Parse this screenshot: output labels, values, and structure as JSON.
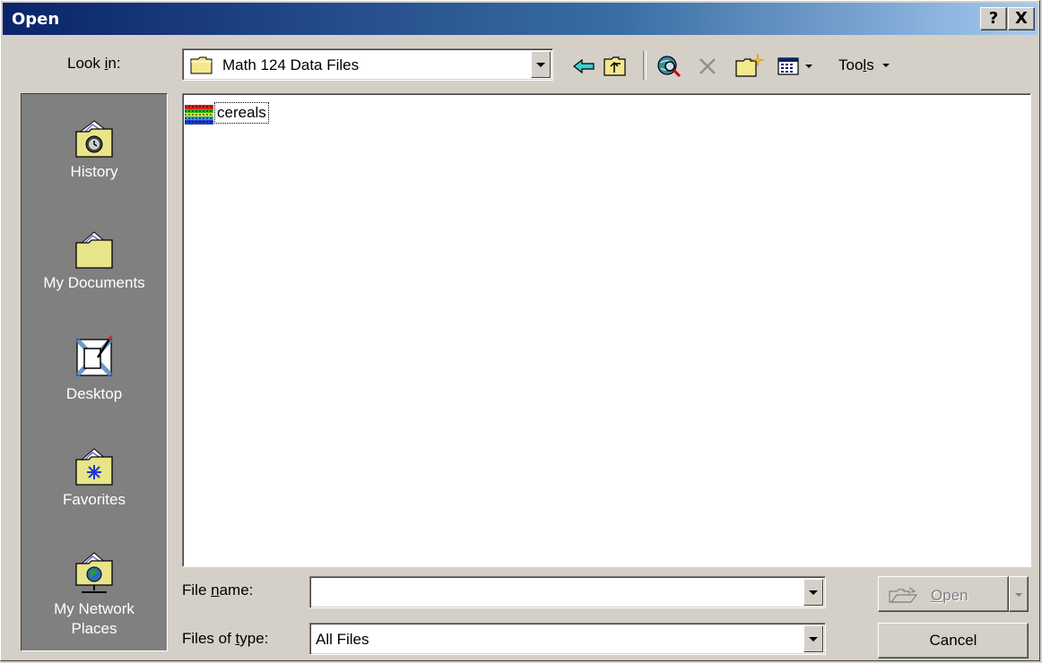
{
  "window": {
    "title": "Open",
    "help_button": "?",
    "close_button": "X"
  },
  "lookin": {
    "label_pre": "Look ",
    "label_accel": "i",
    "label_post": "n:",
    "value": "Math 124 Data Files"
  },
  "toolbar": {
    "back_icon": "back-arrow-icon",
    "up_icon": "up-folder-icon",
    "search_web_icon": "search-web-icon",
    "delete_icon": "delete-icon",
    "new_folder_icon": "new-folder-icon",
    "views_icon": "views-icon",
    "tools_pre": "Too",
    "tools_accel": "l",
    "tools_post": "s"
  },
  "places": [
    {
      "label": "History",
      "icon": "history-icon"
    },
    {
      "label": "My Documents",
      "icon": "my-documents-icon"
    },
    {
      "label": "Desktop",
      "icon": "desktop-icon"
    },
    {
      "label": "Favorites",
      "icon": "favorites-icon"
    },
    {
      "label_line1": "My Network",
      "label_line2": "Places",
      "icon": "network-places-icon"
    }
  ],
  "files": [
    {
      "name": "cereals",
      "icon": "data-file-icon"
    }
  ],
  "filename": {
    "label_pre": "File ",
    "label_accel": "n",
    "label_post": "ame:",
    "value": ""
  },
  "filetype": {
    "label_pre": "Files of ",
    "label_accel": "t",
    "label_post": "ype:",
    "value": "All Files"
  },
  "buttons": {
    "open_accel": "O",
    "open_rest": "pen",
    "cancel": "Cancel"
  }
}
